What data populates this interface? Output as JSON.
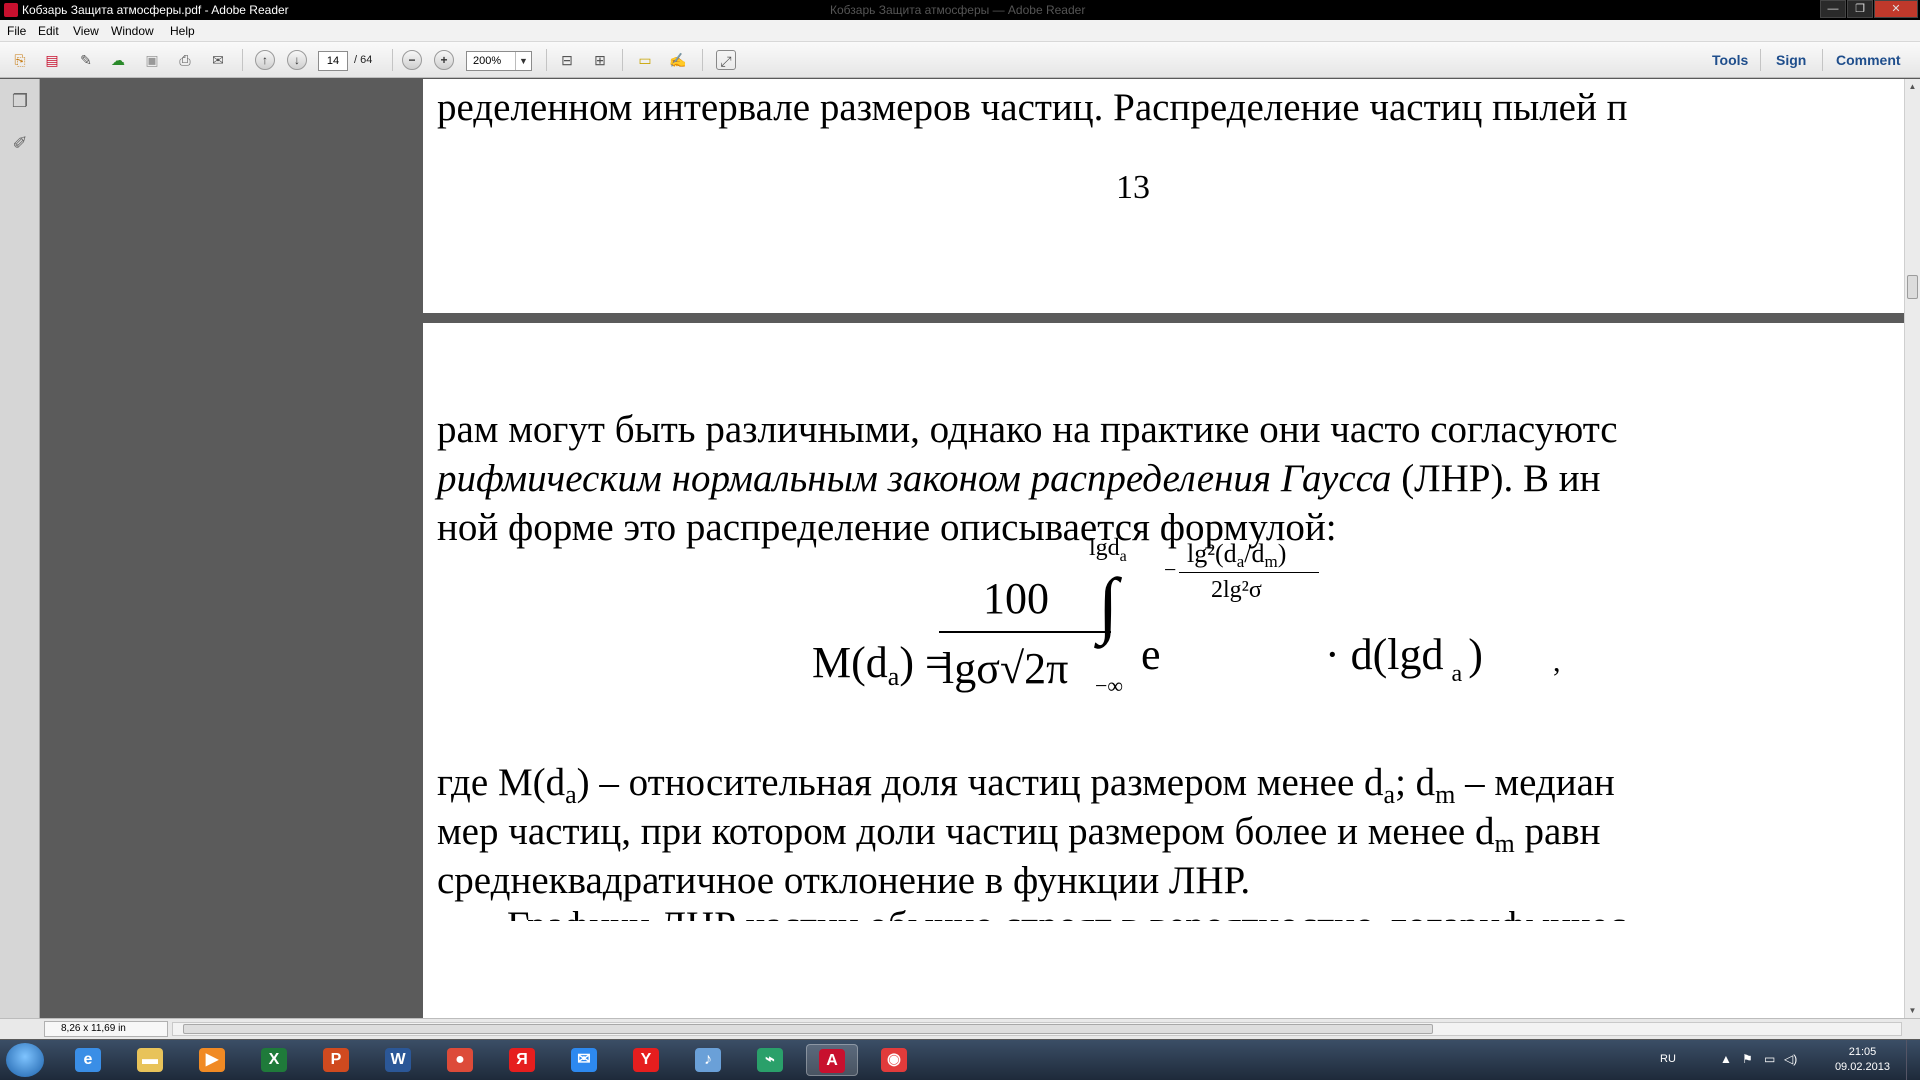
{
  "window": {
    "title": "Кобзарь Защита атмосферы.pdf - Adobe Reader",
    "ghost_title": "Кобзарь Защита атмосферы — Adobe Reader",
    "controls": [
      "—",
      "❐",
      "✕"
    ]
  },
  "menu": [
    "File",
    "Edit",
    "View",
    "Window",
    "Help"
  ],
  "toolbar": {
    "page_current": "14",
    "page_total": "/ 64",
    "zoom": "200%",
    "zoom_dropdown": "▼",
    "right_buttons": [
      "Tools",
      "Sign",
      "Comment"
    ]
  },
  "document": {
    "page_top": {
      "line": "ределенном интервале размеров частиц. Распределение частиц пылей п",
      "page_number": "13"
    },
    "page_bottom": {
      "para1_line1": "рам могут быть различными, однако на практике они часто согласуютс",
      "para1_line2_italic": "рифмическим нормальным законом распределения Гаусса",
      "para1_line2_rest": " (ЛНР). В ин",
      "para1_line3": "ной форме это распределение описывается формулой:",
      "formula": {
        "lhs": "M(d",
        "lhs_sub": "a",
        "lhs_close": ") =",
        "numerator": "100",
        "denominator": "lgσ√2π",
        "integral": "∫",
        "upper_limit": "lgd",
        "upper_limit_sub": "a",
        "lower_limit": "−∞",
        "base": "e",
        "exp_minus": "−",
        "exp_num": "lg²(d",
        "exp_num_sub_a": "a",
        "exp_num_mid": "/d",
        "exp_num_sub_m": "m",
        "exp_num_close": ")",
        "exp_den": "2lg²σ",
        "tail": "· d(lgd",
        "tail_sub": "a",
        "tail_close": ")",
        "comma": ","
      },
      "para2_line1_a": "где M(d",
      "para2_line1_sub1": "a",
      "para2_line1_b": ") – относительная доля частиц размером менее d",
      "para2_line1_sub2": "a",
      "para2_line1_c": "; d",
      "para2_line1_sub3": "m",
      "para2_line1_d": " – медиан",
      "para2_line2_a": "мер частиц, при котором доли частиц размером более и менее d",
      "para2_line2_sub": "m",
      "para2_line2_b": " равн",
      "para2_line3": "среднеквадратичное отклонение в функции ЛНР.",
      "para3_partial": "Графики ЛНР частиц обычно строят в вероятностно-логарифмичес"
    }
  },
  "statusbar": {
    "page_size": "8,26 x 11,69 in"
  },
  "taskbar": {
    "apps": [
      {
        "icon": "internet-explorer-icon",
        "glyph": "e",
        "color": "#3a8ee6"
      },
      {
        "icon": "folder-icon",
        "glyph": "▬",
        "color": "#e8c35a"
      },
      {
        "icon": "media-player-icon",
        "glyph": "▶",
        "color": "#f08a24"
      },
      {
        "icon": "excel-icon",
        "glyph": "X",
        "color": "#1f7a3a"
      },
      {
        "icon": "powerpoint-icon",
        "glyph": "P",
        "color": "#d04a1f"
      },
      {
        "icon": "word-icon",
        "glyph": "W",
        "color": "#2b5797"
      },
      {
        "icon": "chrome-icon",
        "glyph": "●",
        "color": "#dd4b39"
      },
      {
        "icon": "yandex-icon",
        "glyph": "Я",
        "color": "#e61e1e"
      },
      {
        "icon": "mail-icon",
        "glyph": "✉",
        "color": "#2d89ef"
      },
      {
        "icon": "yandex-browser-icon",
        "glyph": "Y",
        "color": "#e61e1e"
      },
      {
        "icon": "sound-icon",
        "glyph": "♪",
        "color": "#6aa0d8"
      },
      {
        "icon": "network-icon",
        "glyph": "⌁",
        "color": "#2aa06a"
      },
      {
        "icon": "adobe-reader-icon",
        "glyph": "A",
        "color": "#c8102e"
      },
      {
        "icon": "app-icon",
        "glyph": "◉",
        "color": "#e23b3b"
      }
    ],
    "tray": {
      "language": "RU",
      "time": "21:05",
      "date": "09.02.2013"
    }
  },
  "colors": {
    "accent": "#1f4e8c",
    "doc_background": "#5b5b5b",
    "page": "#ffffff"
  }
}
